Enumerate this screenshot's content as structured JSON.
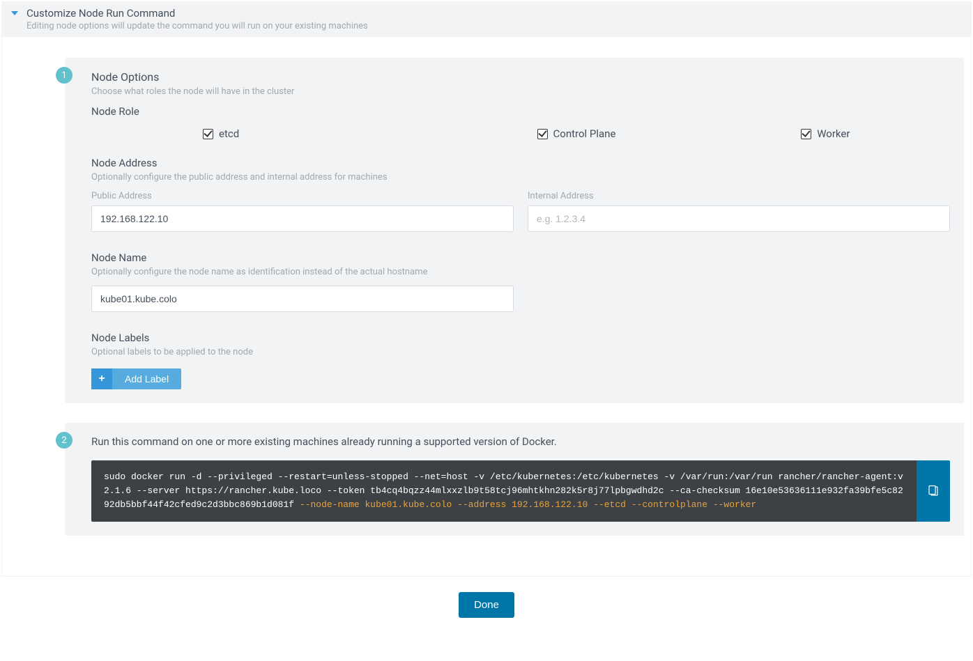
{
  "panel": {
    "title": "Customize Node Run Command",
    "subtitle": "Editing node options will update the command you will run on your existing machines"
  },
  "step1": {
    "badge": "1",
    "title": "Node Options",
    "subtitle": "Choose what roles the node will have in the cluster",
    "node_role_label": "Node Role",
    "roles": {
      "etcd": "etcd",
      "control_plane": "Control Plane",
      "worker": "Worker"
    },
    "node_address": {
      "title": "Node Address",
      "subtitle": "Optionally configure the public address and internal address for machines",
      "public_label": "Public Address",
      "public_value": "192.168.122.10",
      "internal_label": "Internal Address",
      "internal_placeholder": "e.g. 1.2.3.4"
    },
    "node_name": {
      "title": "Node Name",
      "subtitle": "Optionally configure the node name as identification instead of the actual hostname",
      "value": "kube01.kube.colo"
    },
    "node_labels": {
      "title": "Node Labels",
      "subtitle": "Optional labels to be applied to the node",
      "add_label": "Add Label"
    }
  },
  "step2": {
    "badge": "2",
    "title": "Run this command on one or more existing machines already running a supported version of Docker.",
    "cmd_parts": {
      "p1": "sudo docker run -d --privileged --restart=unless-stopped --net=host -v /etc/kubernetes:/etc/kubernetes -v /var/run:/var/run rancher/rancher-agent:v2.1.6 --server https://rancher.kube.loco --token tb4cq4bqzz44mlxxzlb9t58tcj96mhtkhn282k5r8j77lpbgwdhd2c --ca-checksum 16e10e53636111e932fa39bfe5c8292db5bbf44f42cfed9c2d3bbc869b1d081f ",
      "p2": "--node-name kube01.kube.colo",
      "p3": " ",
      "p4": "--address 192.168.122.10",
      "p5": " ",
      "p6": "--etcd",
      "p7": " ",
      "p8": "--controlplane",
      "p9": " ",
      "p10": "--worker"
    }
  },
  "footer": {
    "done": "Done"
  }
}
